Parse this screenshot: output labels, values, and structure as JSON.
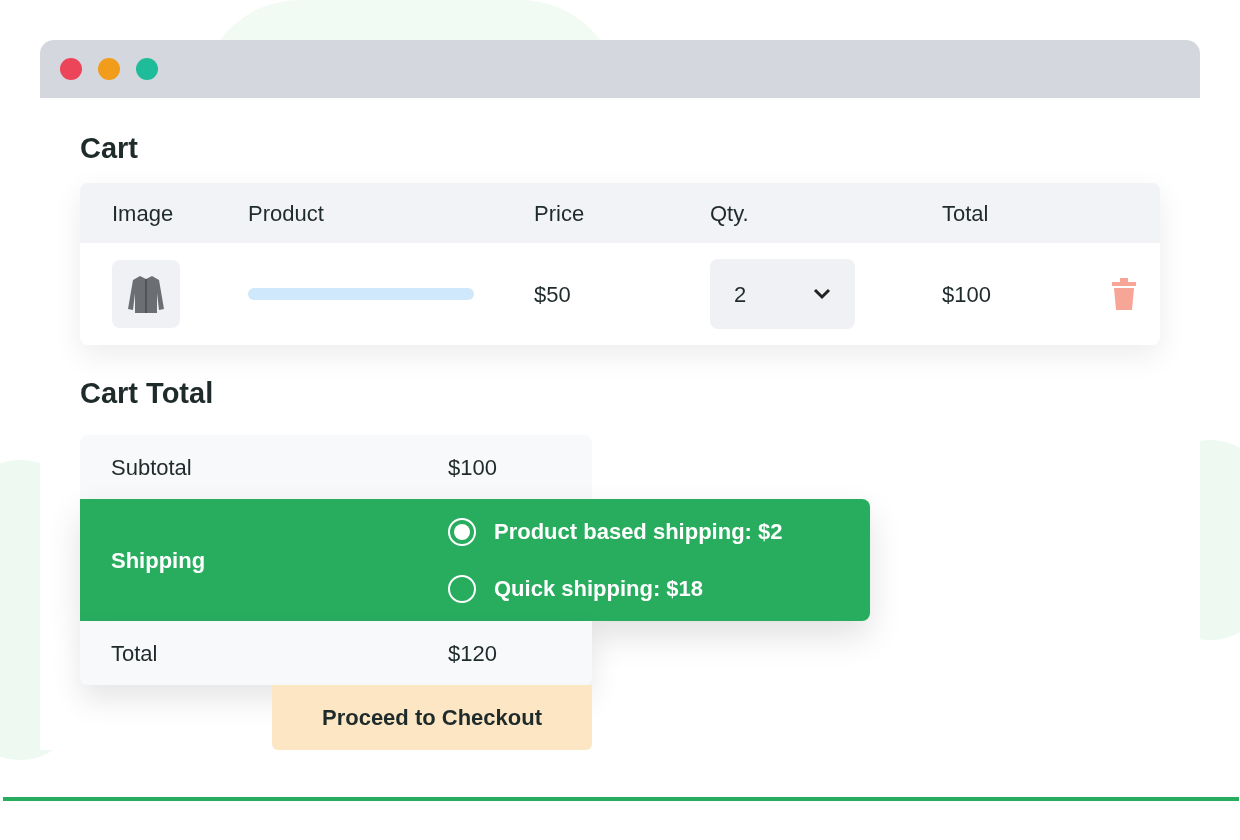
{
  "cart": {
    "title": "Cart",
    "columns": [
      "Image",
      "Product",
      "Price",
      "Qty.",
      "Total"
    ],
    "rows": [
      {
        "price": "$50",
        "qty": "2",
        "total": "$100"
      }
    ]
  },
  "cart_total": {
    "title": "Cart Total",
    "subtotal": {
      "label": "Subtotal",
      "value": "$100"
    },
    "shipping": {
      "label": "Shipping",
      "options": [
        {
          "label": "Product based shipping: $2",
          "selected": true
        },
        {
          "label": "Quick shipping: $18",
          "selected": false
        }
      ]
    },
    "total": {
      "label": "Total",
      "value": "$120"
    },
    "button": "Proceed to Checkout"
  }
}
